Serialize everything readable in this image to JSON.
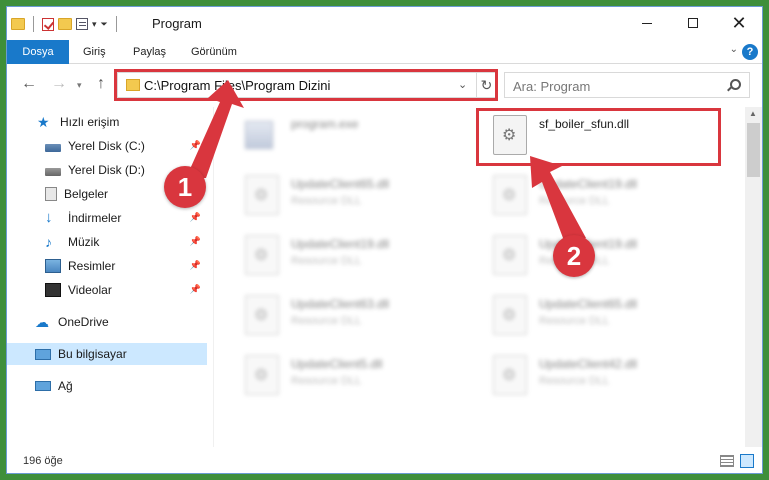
{
  "window": {
    "title": "Program"
  },
  "ribbon": {
    "tabs": [
      {
        "label": "Dosya"
      },
      {
        "label": "Giriş"
      },
      {
        "label": "Paylaş"
      },
      {
        "label": "Görünüm"
      }
    ]
  },
  "address": {
    "path": "C:\\Program Files\\Program Dizini"
  },
  "search": {
    "placeholder": "Ara: Program"
  },
  "sidebar": {
    "items": [
      {
        "label": "Hızlı erişim",
        "icon": "star-icon"
      },
      {
        "label": "Yerel Disk (C:)",
        "icon": "disk-icon"
      },
      {
        "label": "Yerel Disk (D:)",
        "icon": "disk-icon"
      },
      {
        "label": "Belgeler",
        "icon": "documents-icon"
      },
      {
        "label": "İndirmeler",
        "icon": "download-icon"
      },
      {
        "label": "Müzik",
        "icon": "music-icon"
      },
      {
        "label": "Resimler",
        "icon": "pictures-icon"
      },
      {
        "label": "Videolar",
        "icon": "videos-icon"
      },
      {
        "label": "OneDrive",
        "icon": "cloud-icon"
      },
      {
        "label": "Bu bilgisayar",
        "icon": "computer-icon"
      },
      {
        "label": "Ağ",
        "icon": "network-icon"
      }
    ]
  },
  "files": {
    "items": [
      {
        "name": "program.exe",
        "type": ""
      },
      {
        "name": "sf_boiler_sfun.dll",
        "type": ""
      },
      {
        "name": "UpdateClient65.dll",
        "type": "Resource DLL"
      },
      {
        "name": "UpdateClient19.dll",
        "type": "Resource DLL"
      },
      {
        "name": "UpdateClient19.dll",
        "type": "Resource DLL"
      },
      {
        "name": "UpdateClient19.dll",
        "type": "Resource DLL"
      },
      {
        "name": "UpdateClient63.dll",
        "type": "Resource DLL"
      },
      {
        "name": "UpdateClient65.dll",
        "type": "Resource DLL"
      },
      {
        "name": "UpdateClient5.dll",
        "type": "Resource DLL"
      },
      {
        "name": "UpdateClient42.dll",
        "type": "Resource DLL"
      }
    ]
  },
  "status": {
    "item_count": "196 öğe"
  },
  "annotations": {
    "step1": "1",
    "step2": "2"
  },
  "colors": {
    "accent": "#1979ca",
    "highlight": "#d9363e",
    "selected": "#cce8ff"
  }
}
